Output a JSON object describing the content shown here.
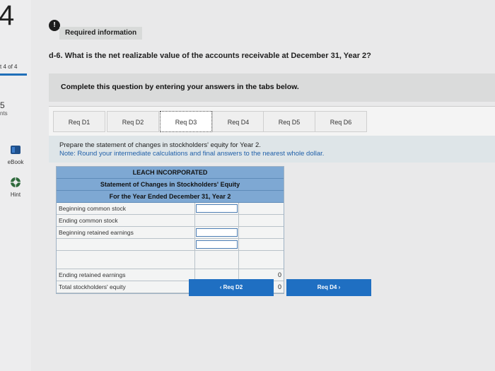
{
  "sidebar": {
    "question_number": "4",
    "question_of": "t 4 of 4",
    "points_number": "5",
    "points_label": "nts",
    "ebook_label": "eBook",
    "hint_label": "Hint"
  },
  "header": {
    "info_icon_text": "!",
    "required_info": "Required information",
    "question": "d-6. What is the net realizable value of the accounts receivable at December 31, Year 2?"
  },
  "instruction": "Complete this question by entering your answers in the tabs below.",
  "tabs": [
    {
      "label": "Req D1",
      "active": false
    },
    {
      "label": "Req D2",
      "active": false
    },
    {
      "label": "Req D3",
      "active": true
    },
    {
      "label": "Req D4",
      "active": false
    },
    {
      "label": "Req D5",
      "active": false
    },
    {
      "label": "Req D6",
      "active": false
    }
  ],
  "tab_content": {
    "prompt": "Prepare the statement of changes in stockholders' equity for Year 2.",
    "note": "Note: Round your intermediate calculations and final answers to the nearest whole dollar."
  },
  "statement": {
    "company": "LEACH INCORPORATED",
    "title": "Statement of Changes in Stockholders' Equity",
    "period": "For the Year Ended December 31, Year 2",
    "rows": [
      {
        "label": "Beginning common stock",
        "value": ""
      },
      {
        "label": "Ending common stock",
        "value": ""
      },
      {
        "label": "Beginning retained earnings",
        "value": ""
      },
      {
        "label": "",
        "value": ""
      },
      {
        "label": "Ending retained earnings",
        "value": "0"
      },
      {
        "label": "Total stockholders' equity",
        "dollar": "$",
        "value": "0"
      }
    ]
  },
  "nav": {
    "prev_label": "Req D2",
    "next_label": "Req D4",
    "prev_icon": "chevron-left-icon",
    "next_icon": "chevron-right-icon"
  },
  "colors": {
    "accent": "#1f6fc2",
    "table_header": "#7ea8d3",
    "note": "#1f5fa8"
  }
}
